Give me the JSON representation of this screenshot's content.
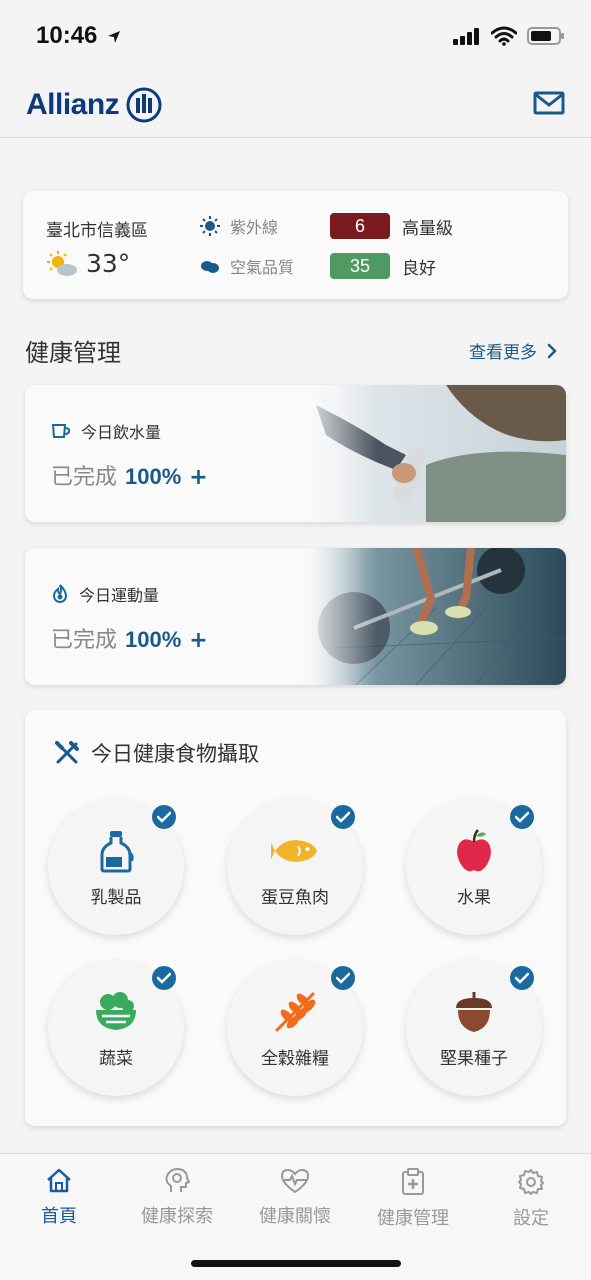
{
  "status_bar": {
    "time": "10:46"
  },
  "header": {
    "brand": "Allianz"
  },
  "weather": {
    "location": "臺北市信義區",
    "temperature": "33°",
    "uv": {
      "label": "紫外線",
      "value": "6",
      "level": "高量級",
      "color": "#7b1a1e"
    },
    "air": {
      "label": "空氣品質",
      "value": "35",
      "level": "良好",
      "color": "#4f9a63"
    }
  },
  "health_section": {
    "title": "健康管理",
    "more_label": "查看更多",
    "cards": [
      {
        "label": "今日飲水量",
        "progress_prefix": "已完成",
        "percent": "100%",
        "plus": "+"
      },
      {
        "label": "今日運動量",
        "progress_prefix": "已完成",
        "percent": "100%",
        "plus": "+"
      }
    ]
  },
  "food_section": {
    "title": "今日健康食物攝取",
    "items": [
      {
        "label": "乳製品",
        "icon": "milk-bottle-icon",
        "checked": true
      },
      {
        "label": "蛋豆魚肉",
        "icon": "fish-icon",
        "checked": true
      },
      {
        "label": "水果",
        "icon": "apple-icon",
        "checked": true
      },
      {
        "label": "蔬菜",
        "icon": "salad-bowl-icon",
        "checked": true
      },
      {
        "label": "全穀雜糧",
        "icon": "wheat-icon",
        "checked": true
      },
      {
        "label": "堅果種子",
        "icon": "acorn-icon",
        "checked": true
      }
    ]
  },
  "bottom_nav": {
    "items": [
      {
        "label": "首頁",
        "active": true
      },
      {
        "label": "健康探索",
        "active": false
      },
      {
        "label": "健康關懷",
        "active": false
      },
      {
        "label": "健康管理",
        "active": false
      },
      {
        "label": "設定",
        "active": false
      }
    ]
  },
  "colors": {
    "brand": "#0d3a7a",
    "accent": "#1a5a8a",
    "check": "#1a6aa0"
  }
}
